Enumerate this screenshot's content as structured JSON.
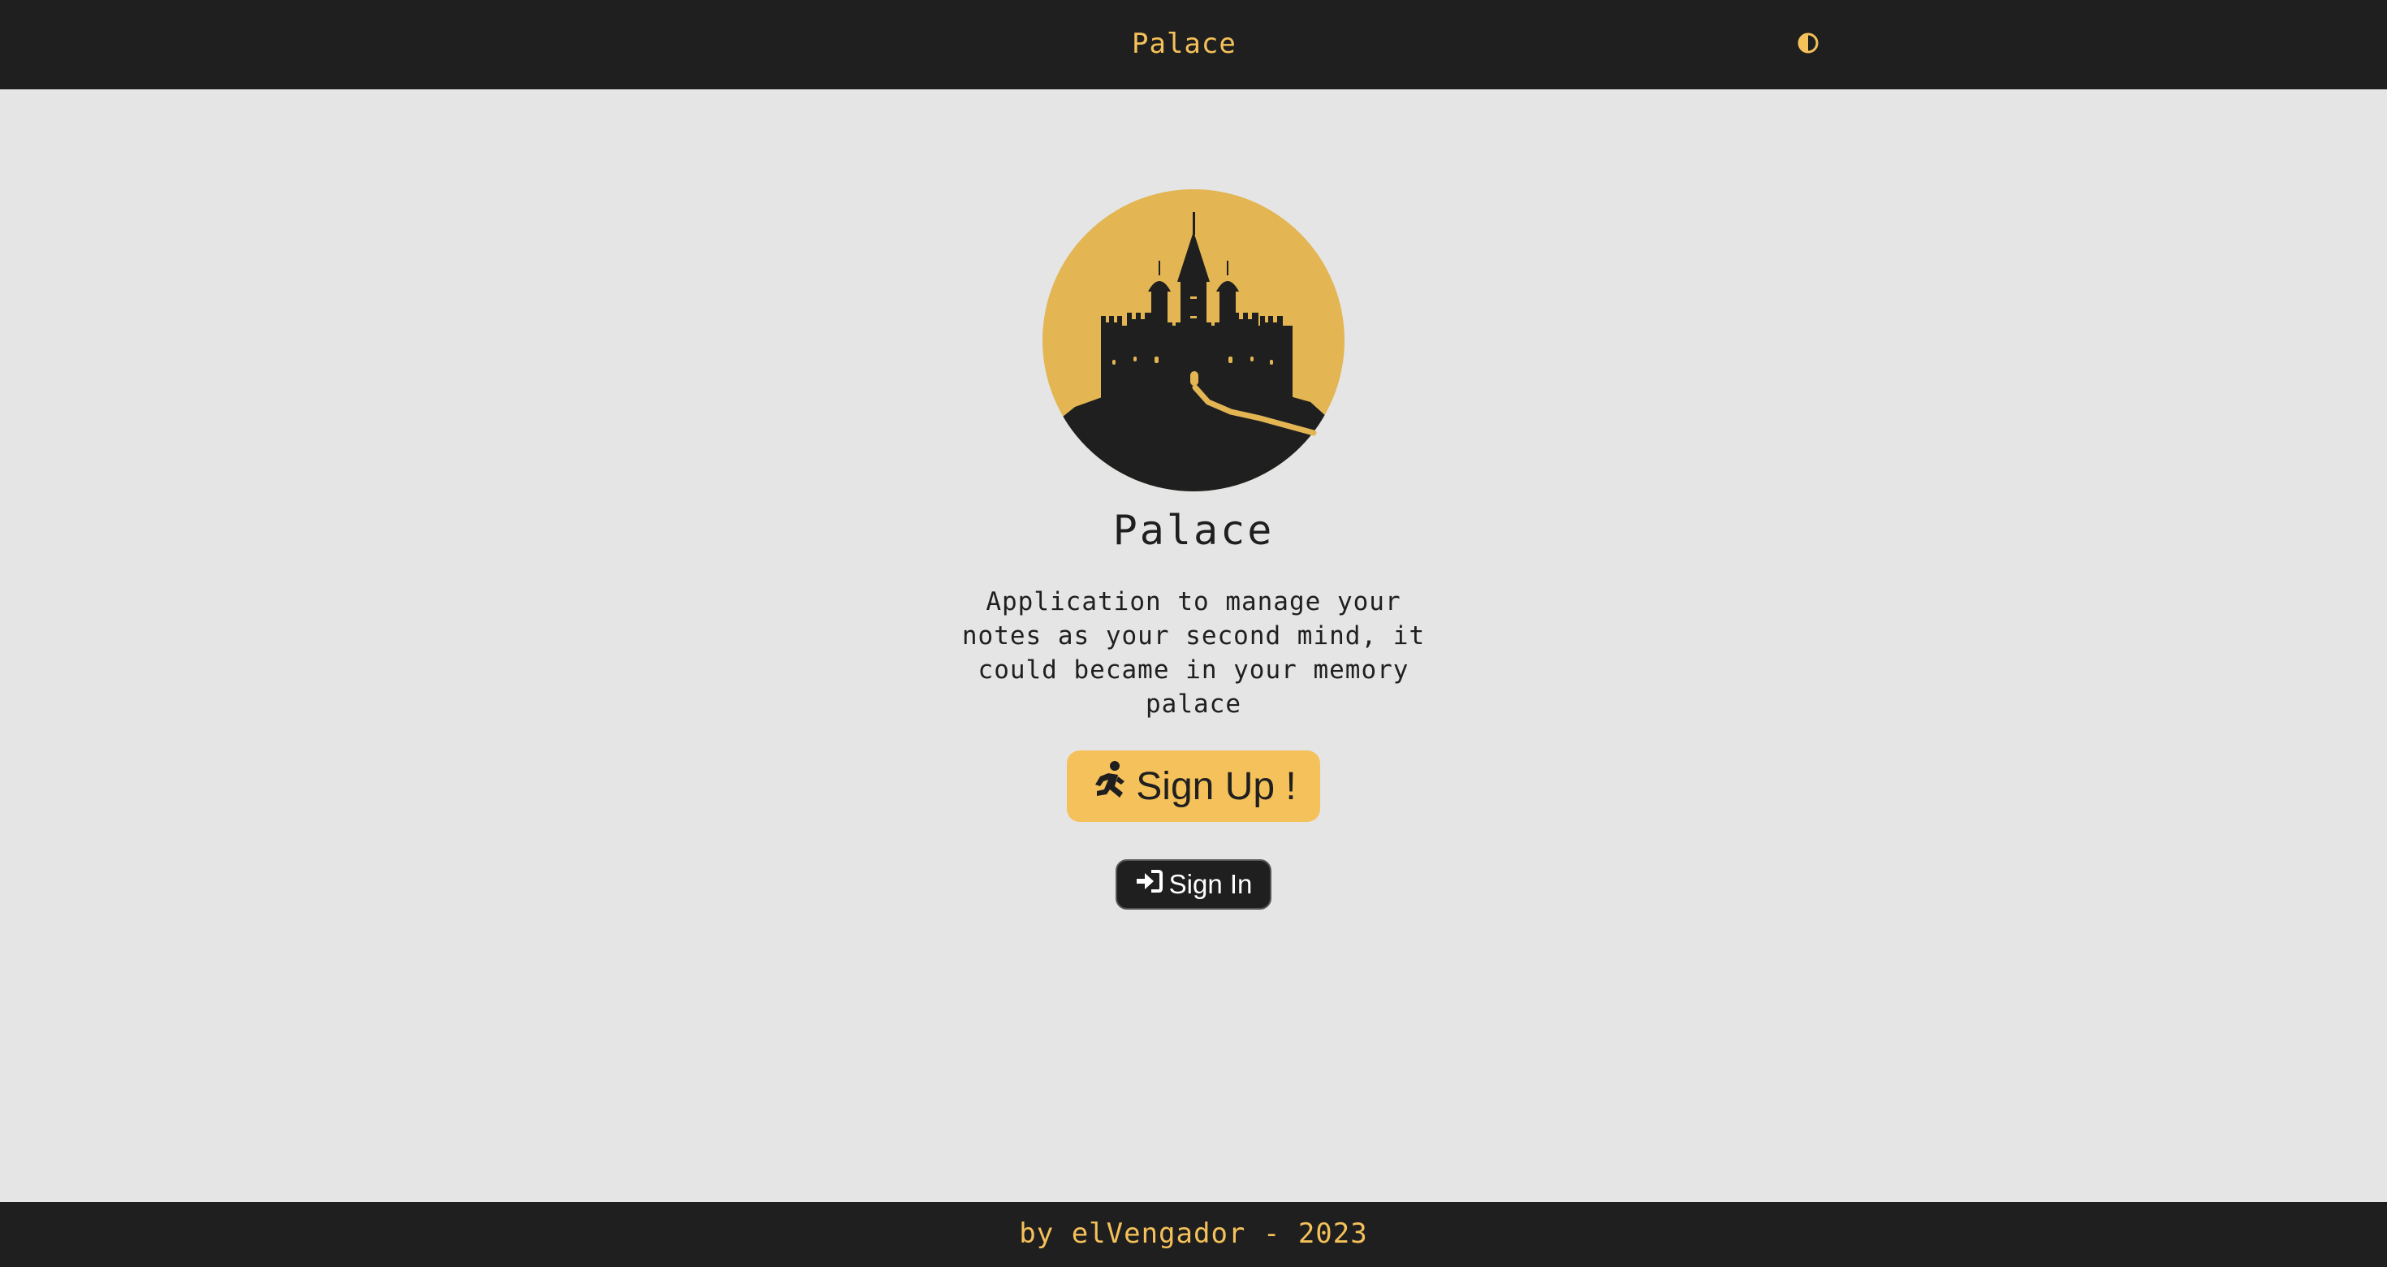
{
  "header": {
    "title": "Palace",
    "theme_toggle_icon": "contrast-half-circle-icon"
  },
  "hero": {
    "logo_icon": "castle-logo-icon",
    "title": "Palace",
    "description": "Application to manage your notes as your second mind, it could became in your memory palace"
  },
  "actions": {
    "signup_label": "Sign Up !",
    "signup_icon": "running-person-icon",
    "signin_label": "Sign In",
    "signin_icon": "sign-in-arrow-icon"
  },
  "footer": {
    "text": "by elVengador - 2023"
  },
  "colors": {
    "bar_background": "#1f1f1f",
    "page_background": "#e5e5e5",
    "accent": "#f5c15a",
    "logo_circle": "#e3b553"
  }
}
